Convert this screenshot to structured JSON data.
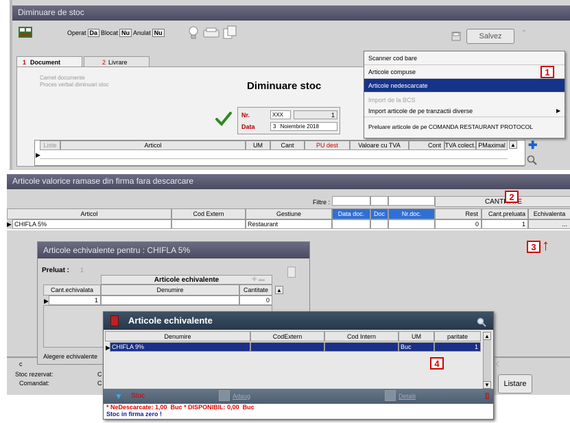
{
  "w1": {
    "title": "Diminuare de stoc",
    "toolbar": {
      "operat": "Operat",
      "da": "Da",
      "blocat": "Blocat",
      "nu1": "Nu",
      "anulat": "Anulat",
      "nu2": "Nu"
    },
    "save": "Salvez",
    "tabs": [
      {
        "num": "1",
        "label": "Document"
      },
      {
        "num": "2",
        "label": "Livrare"
      }
    ],
    "carnet_label": "Carnet documente",
    "carnet_value": "Proces verbal diminuari stoc",
    "heading": "Diminuare stoc",
    "nr_label": "Nr.",
    "nr_prefix": "XXX",
    "nr_value": "1",
    "data_label": "Data",
    "date_day": "3",
    "date_rest": "Noiembrie 2018",
    "grid_headers": [
      "Liste",
      "Articol",
      "UM",
      "Cant",
      "PU dest",
      "Valoare cu TVA",
      "Cont",
      "TVA colect.",
      "PMaximal"
    ],
    "menu": [
      "Scanner cod bare",
      "Articole compuse",
      "Articole nedescarcate",
      "Import de la BCS",
      "Import articole de pe tranzactii diverse",
      "Preluare articole de pe COMANDA RESTAURANT PROTOCOL"
    ]
  },
  "w2": {
    "title": "Articole valorice ramase din firma fara descarcare",
    "filter_label": "Filtre :",
    "cantitate_header": "CANTITATE",
    "headers": [
      "Articol",
      "Cod Extern",
      "Gestiune",
      "Data doc.",
      "Doc",
      "Nr.doc.",
      "Rest",
      "Cant.preluata",
      "Echivalenta"
    ],
    "row": {
      "articol": "CHIFLA 5%",
      "cod": "",
      "gestiune": "Restaurant",
      "rest": "0",
      "cant": "1",
      "ech": "..."
    },
    "stoc_rezervat": "Stoc rezervat:",
    "comandat": "Comandat:",
    "c_val": "C",
    "c_val2": "C",
    "c_letter": "c"
  },
  "w3": {
    "title": "Articole echivalente pentru : CHIFLA 5%",
    "preluat_label": "Preluat :",
    "preluat_value": "1",
    "group_header": "Articole echivalente",
    "headers": [
      "Cant.echivalata",
      "Denumire",
      "Cantitate"
    ],
    "row": {
      "cant": "1",
      "den": "",
      "qty": "0"
    },
    "alegere": "Alegere echivalente"
  },
  "w4": {
    "title": "Articole echivalente",
    "headers": [
      "Denumire",
      "CodExtern",
      "Cod Intern",
      "UM",
      "paritate"
    ],
    "row": {
      "den": "CHIFLA 9%",
      "codext": "",
      "codint": "",
      "um": "Buc",
      "par": "1"
    },
    "stoc": "Stoc",
    "adaug": "Adaug",
    "detalii": "Detalii",
    "b": "B",
    "status1": "* NeDescarcate: 1,00  Buc * DISPONIBIL: 0,00  Buc",
    "status2": "Stoc in firma zero !"
  },
  "listare": "Listare",
  "markers": [
    "1",
    "2",
    "3",
    "4"
  ],
  "arrow": "↑"
}
